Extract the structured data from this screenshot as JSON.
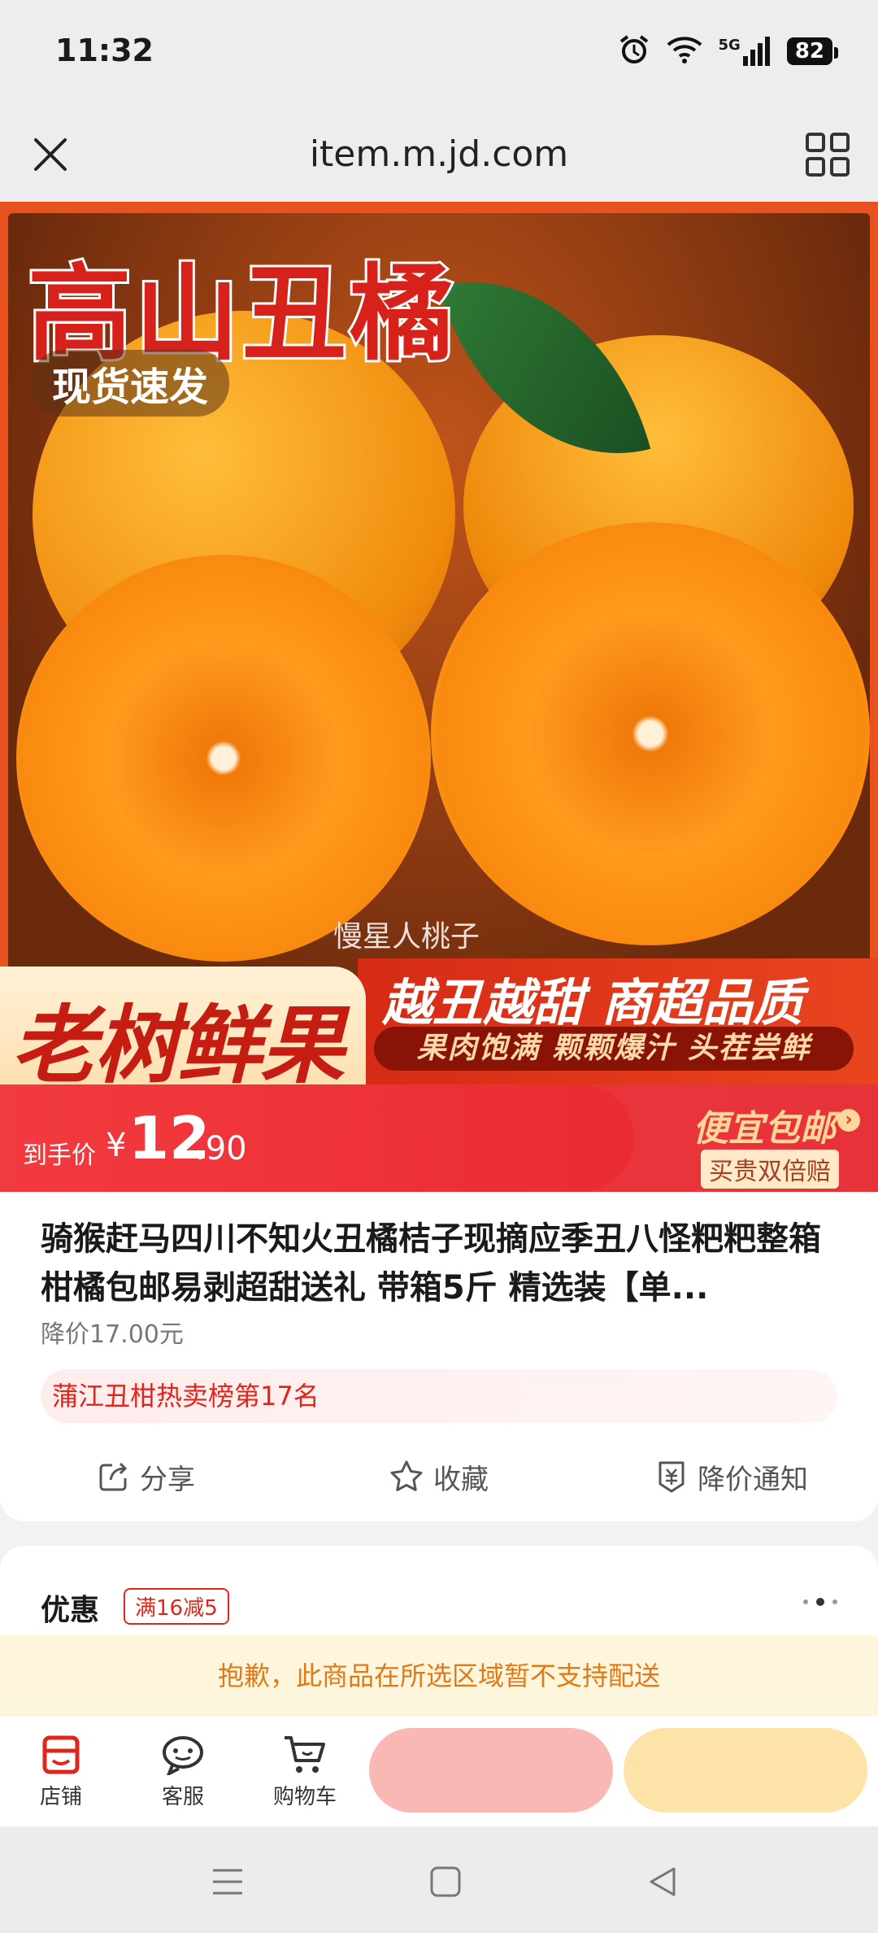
{
  "status_bar": {
    "time": "11:32",
    "network": "5G",
    "battery": "82"
  },
  "url_bar": {
    "url": "item.m.jd.com"
  },
  "hero": {
    "title": "高山丑橘",
    "tag": "现货速发",
    "watermark": "慢星人桃子",
    "banner_left": "老树鲜果",
    "banner_right_main": "越丑越甜 商超品质",
    "banner_right_sub": "果肉饱满 颗颗爆汁 头茬尝鲜"
  },
  "price": {
    "label": "到手价",
    "currency": "¥",
    "integer": "12",
    "decimal": ".90",
    "promo": "便宜包邮",
    "promo_sub": "买贵双倍赔"
  },
  "product": {
    "title": "骑猴赶马四川不知火丑橘桔子现摘应季丑八怪粑粑整箱柑橘包邮易剥超甜送礼 带箱5斤 精选装【单...",
    "old_price": "降价17.00元",
    "rank": "蒲江丑柑热卖榜第17名"
  },
  "actions": [
    {
      "label": "分享",
      "icon": "share-icon"
    },
    {
      "label": "收藏",
      "icon": "star-icon"
    },
    {
      "label": "降价通知",
      "icon": "price-alert-icon"
    }
  ],
  "offers": {
    "label": "优惠",
    "tag": "满16减5"
  },
  "notice": "抱歉，此商品在所选区域暂不支持配送",
  "bottom_nav": [
    {
      "label": "店铺",
      "icon": "store-icon"
    },
    {
      "label": "客服",
      "icon": "chat-icon"
    },
    {
      "label": "购物车",
      "icon": "cart-icon"
    }
  ],
  "colors": {
    "accent": "#e1251b",
    "cart_button": "#f9b8b4",
    "buy_button": "#fde3a7",
    "notice_text": "#e07a18"
  }
}
